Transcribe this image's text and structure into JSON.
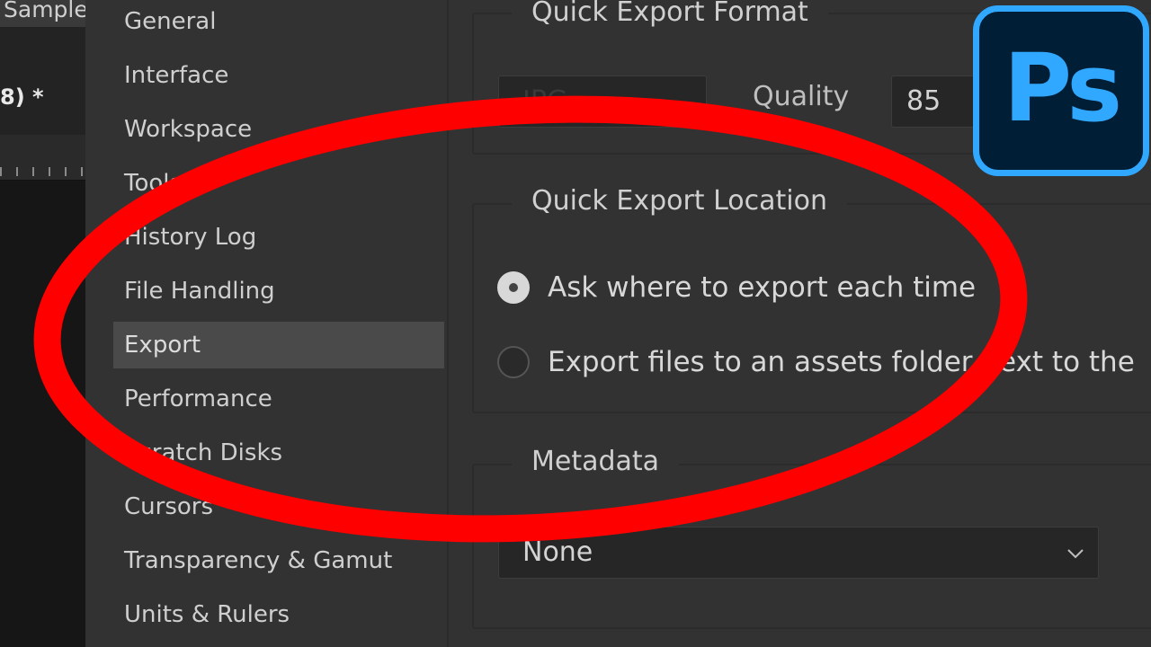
{
  "app": {
    "tab_label": "Sample",
    "doc_tab_label": "8) *"
  },
  "nav": {
    "items": [
      {
        "label": "General"
      },
      {
        "label": "Interface"
      },
      {
        "label": "Workspace"
      },
      {
        "label": "Tools"
      },
      {
        "label": "History Log"
      },
      {
        "label": "File Handling"
      },
      {
        "label": "Export",
        "selected": true
      },
      {
        "label": "Performance"
      },
      {
        "label": "Scratch Disks"
      },
      {
        "label": "Cursors"
      },
      {
        "label": "Transparency & Gamut"
      },
      {
        "label": "Units & Rulers"
      }
    ]
  },
  "quick_export_format": {
    "title": "Quick Export Format",
    "format_value": "JPG",
    "quality_label": "Quality",
    "quality_value": "85"
  },
  "quick_export_location": {
    "title": "Quick Export Location",
    "option_ask": "Ask where to export each time",
    "option_assets": "Export files to an assets folder next to the",
    "selected": "option_ask"
  },
  "metadata": {
    "title": "Metadata",
    "value": "None"
  },
  "logo": {
    "text": "Ps",
    "color": "#31a8ff",
    "background": "#001e36"
  },
  "annotation_color": "#ff0000"
}
